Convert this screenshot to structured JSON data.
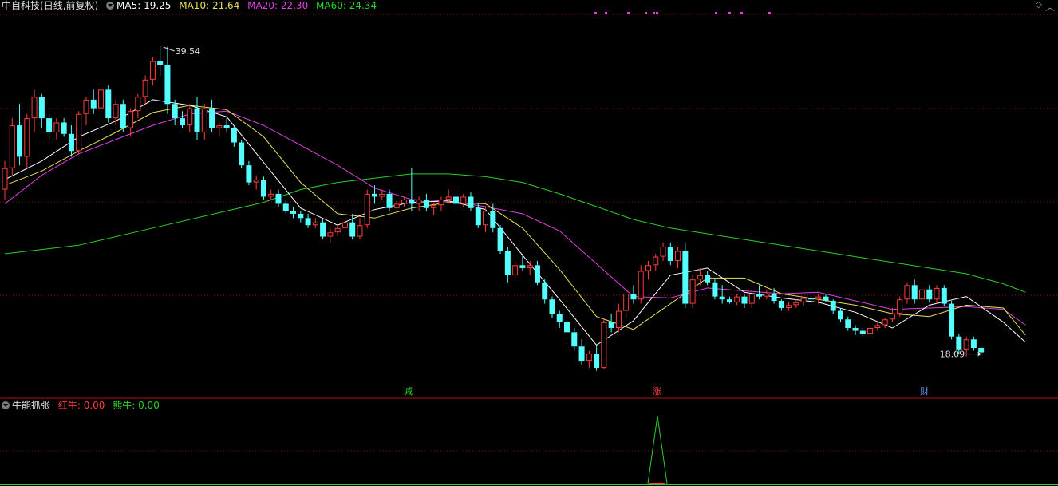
{
  "header": {
    "stock_name": "中自科技",
    "period": "(日线,前复权)",
    "ma5_label": "MA5: 19.25",
    "ma10_label": "MA10: 21.64",
    "ma20_label": "MA20: 22.30",
    "ma60_label": "MA60: 24.34"
  },
  "sub_header": {
    "indicator_name": "牛能抓张",
    "red_label": "红牛: 0.00",
    "bear_label": "熊牛: 0.00"
  },
  "colors": {
    "up": "#ff3c3c",
    "down": "#54ffff",
    "ma5": "#ffffff",
    "ma10": "#e8e056",
    "ma20": "#e040e0",
    "ma60": "#2ad22a",
    "grid": "#8b1010"
  },
  "markers": [
    {
      "label": "减",
      "color": "#2ad22a"
    },
    {
      "label": "涨",
      "color": "#ff3c3c"
    },
    {
      "label": "财",
      "color": "#6aa0ff"
    }
  ],
  "chart_data": {
    "type": "candlestick",
    "annotations": {
      "high": "39.54",
      "low": "18.09"
    },
    "ylim": [
      16.5,
      42
    ],
    "candles": [
      [
        29.5,
        31.5,
        28.8,
        31.0
      ],
      [
        31.0,
        34.5,
        30.5,
        34.0
      ],
      [
        34.0,
        35.5,
        31.2,
        31.8
      ],
      [
        31.8,
        34.8,
        31.0,
        34.5
      ],
      [
        34.5,
        36.5,
        33.5,
        36.0
      ],
      [
        36.0,
        36.2,
        33.8,
        34.5
      ],
      [
        34.5,
        34.8,
        33.0,
        33.5
      ],
      [
        33.5,
        34.5,
        33.0,
        34.2
      ],
      [
        34.2,
        34.5,
        33.2,
        33.4
      ],
      [
        33.4,
        34.0,
        31.8,
        32.2
      ],
      [
        32.2,
        35.0,
        32.0,
        34.8
      ],
      [
        34.8,
        36.0,
        34.0,
        35.8
      ],
      [
        35.8,
        36.5,
        34.8,
        35.2
      ],
      [
        35.2,
        36.8,
        34.5,
        36.5
      ],
      [
        36.5,
        36.8,
        34.2,
        34.5
      ],
      [
        34.5,
        35.8,
        34.0,
        35.5
      ],
      [
        35.5,
        35.8,
        33.5,
        33.8
      ],
      [
        33.8,
        35.2,
        33.2,
        35.0
      ],
      [
        35.0,
        36.2,
        34.5,
        36.0
      ],
      [
        36.0,
        37.5,
        35.5,
        37.2
      ],
      [
        37.2,
        38.8,
        36.8,
        38.5
      ],
      [
        38.5,
        39.54,
        37.5,
        38.2
      ],
      [
        38.2,
        39.5,
        34.8,
        35.5
      ],
      [
        35.5,
        35.8,
        34.0,
        34.5
      ],
      [
        34.5,
        35.0,
        33.8,
        34.0
      ],
      [
        34.0,
        35.5,
        33.5,
        35.2
      ],
      [
        35.2,
        36.0,
        33.0,
        33.5
      ],
      [
        33.5,
        35.5,
        33.0,
        35.2
      ],
      [
        35.2,
        35.8,
        33.5,
        33.8
      ],
      [
        33.8,
        34.2,
        33.2,
        34.0
      ],
      [
        34.0,
        34.5,
        33.5,
        33.8
      ],
      [
        33.8,
        34.0,
        32.5,
        32.8
      ],
      [
        32.8,
        33.0,
        31.0,
        31.2
      ],
      [
        31.2,
        31.5,
        29.8,
        30.0
      ],
      [
        30.0,
        30.5,
        29.5,
        30.2
      ],
      [
        30.2,
        30.4,
        28.8,
        29.0
      ],
      [
        29.0,
        29.5,
        28.8,
        29.2
      ],
      [
        29.2,
        29.5,
        28.3,
        28.5
      ],
      [
        28.5,
        28.8,
        27.8,
        28.0
      ],
      [
        28.0,
        28.3,
        27.5,
        27.8
      ],
      [
        27.8,
        28.0,
        27.2,
        27.5
      ],
      [
        27.5,
        27.8,
        26.8,
        27.0
      ],
      [
        27.0,
        27.5,
        26.8,
        27.2
      ],
      [
        27.2,
        27.4,
        26.0,
        26.2
      ],
      [
        26.2,
        26.8,
        25.8,
        26.5
      ],
      [
        26.5,
        27.0,
        26.2,
        26.8
      ],
      [
        26.8,
        27.5,
        26.5,
        27.2
      ],
      [
        27.2,
        27.8,
        26.0,
        26.2
      ],
      [
        26.2,
        27.5,
        26.0,
        27.0
      ],
      [
        27.0,
        29.5,
        26.8,
        29.2
      ],
      [
        29.2,
        29.8,
        28.5,
        29.0
      ],
      [
        29.0,
        29.5,
        28.8,
        29.2
      ],
      [
        29.2,
        29.5,
        28.0,
        28.2
      ],
      [
        28.2,
        28.8,
        27.8,
        28.5
      ],
      [
        28.5,
        29.0,
        28.3,
        28.8
      ],
      [
        28.8,
        31.0,
        28.0,
        28.5
      ],
      [
        28.5,
        29.0,
        28.0,
        28.8
      ],
      [
        28.8,
        29.2,
        28.0,
        28.2
      ],
      [
        28.2,
        28.6,
        27.7,
        28.4
      ],
      [
        28.4,
        29.0,
        28.0,
        28.8
      ],
      [
        28.8,
        29.5,
        28.5,
        29.0
      ],
      [
        29.0,
        29.5,
        28.2,
        28.5
      ],
      [
        28.5,
        29.2,
        28.3,
        29.0
      ],
      [
        29.0,
        29.3,
        28.0,
        28.2
      ],
      [
        28.2,
        28.5,
        26.8,
        27.0
      ],
      [
        27.0,
        28.3,
        26.5,
        28.0
      ],
      [
        28.0,
        28.5,
        26.5,
        26.8
      ],
      [
        26.8,
        27.0,
        25.0,
        25.2
      ],
      [
        25.2,
        25.5,
        23.0,
        23.5
      ],
      [
        23.5,
        24.5,
        23.2,
        24.2
      ],
      [
        24.2,
        25.0,
        23.8,
        24.0
      ],
      [
        24.0,
        24.5,
        23.5,
        24.2
      ],
      [
        24.2,
        24.5,
        22.8,
        23.0
      ],
      [
        23.0,
        23.2,
        21.5,
        21.8
      ],
      [
        21.8,
        22.0,
        20.5,
        20.8
      ],
      [
        20.8,
        21.0,
        19.8,
        20.2
      ],
      [
        20.2,
        20.5,
        19.0,
        19.5
      ],
      [
        19.5,
        19.8,
        18.2,
        18.5
      ],
      [
        18.5,
        19.0,
        17.2,
        17.5
      ],
      [
        17.5,
        18.2,
        17.0,
        18.0
      ],
      [
        18.0,
        18.5,
        16.8,
        17.0
      ],
      [
        17.0,
        20.5,
        16.9,
        20.2
      ],
      [
        20.2,
        20.8,
        19.5,
        19.8
      ],
      [
        19.8,
        21.5,
        19.5,
        21.0
      ],
      [
        21.0,
        22.5,
        20.5,
        22.2
      ],
      [
        22.2,
        22.8,
        21.5,
        21.8
      ],
      [
        21.8,
        24.2,
        21.5,
        23.8
      ],
      [
        23.8,
        24.5,
        23.2,
        24.2
      ],
      [
        24.2,
        25.0,
        23.8,
        24.8
      ],
      [
        24.8,
        25.8,
        24.5,
        25.5
      ],
      [
        25.5,
        25.8,
        24.2,
        24.5
      ],
      [
        24.5,
        25.5,
        24.0,
        25.2
      ],
      [
        25.2,
        25.8,
        21.2,
        21.5
      ],
      [
        21.5,
        23.5,
        21.2,
        23.2
      ],
      [
        23.2,
        24.0,
        22.8,
        23.5
      ],
      [
        23.5,
        23.8,
        22.8,
        23.0
      ],
      [
        23.0,
        23.2,
        21.8,
        22.0
      ],
      [
        22.0,
        22.8,
        21.5,
        21.8
      ],
      [
        21.8,
        22.0,
        21.5,
        21.6
      ],
      [
        21.6,
        22.2,
        21.4,
        22.0
      ],
      [
        22.0,
        22.2,
        21.2,
        21.5
      ],
      [
        21.5,
        22.5,
        21.2,
        22.2
      ],
      [
        22.2,
        22.8,
        21.8,
        22.0
      ],
      [
        22.0,
        22.5,
        21.8,
        22.2
      ],
      [
        22.2,
        22.6,
        21.5,
        21.7
      ],
      [
        21.7,
        21.8,
        21.0,
        21.2
      ],
      [
        21.2,
        21.6,
        21.0,
        21.4
      ],
      [
        21.4,
        21.8,
        21.2,
        21.6
      ],
      [
        21.6,
        22.0,
        21.4,
        21.9
      ],
      [
        21.9,
        22.2,
        21.6,
        21.8
      ],
      [
        21.8,
        22.2,
        21.5,
        22.0
      ],
      [
        22.0,
        22.2,
        21.6,
        21.7
      ],
      [
        21.7,
        21.8,
        20.8,
        21.0
      ],
      [
        21.0,
        21.2,
        20.2,
        20.4
      ],
      [
        20.4,
        20.6,
        19.6,
        19.8
      ],
      [
        19.8,
        20.0,
        19.3,
        19.6
      ],
      [
        19.6,
        19.8,
        19.2,
        19.4
      ],
      [
        19.4,
        19.9,
        19.3,
        19.8
      ],
      [
        19.8,
        20.2,
        19.6,
        20.0
      ],
      [
        20.0,
        20.5,
        19.8,
        20.4
      ],
      [
        20.4,
        21.2,
        20.2,
        20.8
      ],
      [
        20.8,
        22.0,
        20.6,
        21.8
      ],
      [
        21.8,
        23.0,
        21.5,
        22.8
      ],
      [
        22.8,
        23.2,
        21.5,
        21.8
      ],
      [
        21.8,
        22.8,
        21.6,
        22.5
      ],
      [
        22.5,
        22.8,
        21.6,
        21.8
      ],
      [
        21.8,
        22.8,
        21.5,
        22.6
      ],
      [
        22.6,
        22.8,
        21.3,
        21.5
      ],
      [
        21.5,
        21.7,
        19.0,
        19.2
      ],
      [
        19.2,
        19.4,
        18.0,
        18.3
      ],
      [
        18.3,
        19.2,
        17.8,
        19.0
      ],
      [
        19.0,
        19.2,
        18.2,
        18.4
      ],
      [
        18.4,
        18.6,
        17.9,
        18.09
      ]
    ],
    "ma5": [
      [
        0,
        30.2
      ],
      [
        5,
        31.5
      ],
      [
        10,
        33.2
      ],
      [
        15,
        34.3
      ],
      [
        20,
        35.8
      ],
      [
        25,
        35.4
      ],
      [
        30,
        34.6
      ],
      [
        35,
        31.4
      ],
      [
        40,
        28.2
      ],
      [
        45,
        27.0
      ],
      [
        50,
        28.1
      ],
      [
        55,
        28.6
      ],
      [
        60,
        28.7
      ],
      [
        65,
        28.1
      ],
      [
        70,
        24.9
      ],
      [
        75,
        21.8
      ],
      [
        80,
        18.6
      ],
      [
        85,
        20.3
      ],
      [
        90,
        23.5
      ],
      [
        95,
        24.0
      ],
      [
        100,
        22.3
      ],
      [
        105,
        21.9
      ],
      [
        110,
        21.6
      ],
      [
        115,
        20.9
      ],
      [
        120,
        19.8
      ],
      [
        125,
        21.4
      ],
      [
        130,
        22.0
      ],
      [
        135,
        20.2
      ],
      [
        138,
        18.8
      ]
    ],
    "ma10": [
      [
        0,
        29.8
      ],
      [
        5,
        30.8
      ],
      [
        10,
        32.2
      ],
      [
        15,
        33.5
      ],
      [
        20,
        34.9
      ],
      [
        25,
        35.4
      ],
      [
        30,
        35.1
      ],
      [
        35,
        33.2
      ],
      [
        40,
        30.0
      ],
      [
        45,
        27.8
      ],
      [
        50,
        27.5
      ],
      [
        55,
        28.2
      ],
      [
        60,
        28.6
      ],
      [
        65,
        28.5
      ],
      [
        70,
        26.8
      ],
      [
        75,
        23.9
      ],
      [
        80,
        20.6
      ],
      [
        85,
        19.7
      ],
      [
        90,
        21.5
      ],
      [
        95,
        23.3
      ],
      [
        100,
        23.3
      ],
      [
        105,
        22.2
      ],
      [
        110,
        21.8
      ],
      [
        115,
        21.4
      ],
      [
        120,
        20.8
      ],
      [
        125,
        20.6
      ],
      [
        130,
        21.4
      ],
      [
        135,
        21.2
      ],
      [
        138,
        19.3
      ]
    ],
    "ma20": [
      [
        0,
        28.5
      ],
      [
        5,
        30.5
      ],
      [
        10,
        32.0
      ],
      [
        15,
        33.0
      ],
      [
        20,
        34.0
      ],
      [
        25,
        34.8
      ],
      [
        30,
        35.0
      ],
      [
        35,
        34.0
      ],
      [
        40,
        32.6
      ],
      [
        45,
        31.2
      ],
      [
        50,
        29.6
      ],
      [
        55,
        28.8
      ],
      [
        60,
        28.7
      ],
      [
        65,
        28.3
      ],
      [
        70,
        27.8
      ],
      [
        75,
        26.6
      ],
      [
        80,
        24.3
      ],
      [
        85,
        22.0
      ],
      [
        90,
        21.9
      ],
      [
        95,
        22.6
      ],
      [
        100,
        22.4
      ],
      [
        105,
        22.2
      ],
      [
        110,
        22.3
      ],
      [
        115,
        21.7
      ],
      [
        120,
        21.1
      ],
      [
        125,
        21.2
      ],
      [
        130,
        21.3
      ],
      [
        135,
        21.1
      ],
      [
        138,
        20.0
      ]
    ],
    "ma60": [
      [
        0,
        25.0
      ],
      [
        10,
        25.6
      ],
      [
        20,
        26.8
      ],
      [
        30,
        28.0
      ],
      [
        35,
        28.6
      ],
      [
        40,
        29.5
      ],
      [
        45,
        30.0
      ],
      [
        50,
        30.3
      ],
      [
        55,
        30.6
      ],
      [
        60,
        30.6
      ],
      [
        65,
        30.4
      ],
      [
        70,
        30.0
      ],
      [
        75,
        29.2
      ],
      [
        80,
        28.3
      ],
      [
        85,
        27.4
      ],
      [
        90,
        26.8
      ],
      [
        95,
        26.4
      ],
      [
        100,
        26.0
      ],
      [
        105,
        25.6
      ],
      [
        110,
        25.2
      ],
      [
        115,
        24.8
      ],
      [
        120,
        24.4
      ],
      [
        125,
        24.0
      ],
      [
        130,
        23.6
      ],
      [
        135,
        22.9
      ],
      [
        138,
        22.3
      ]
    ]
  }
}
